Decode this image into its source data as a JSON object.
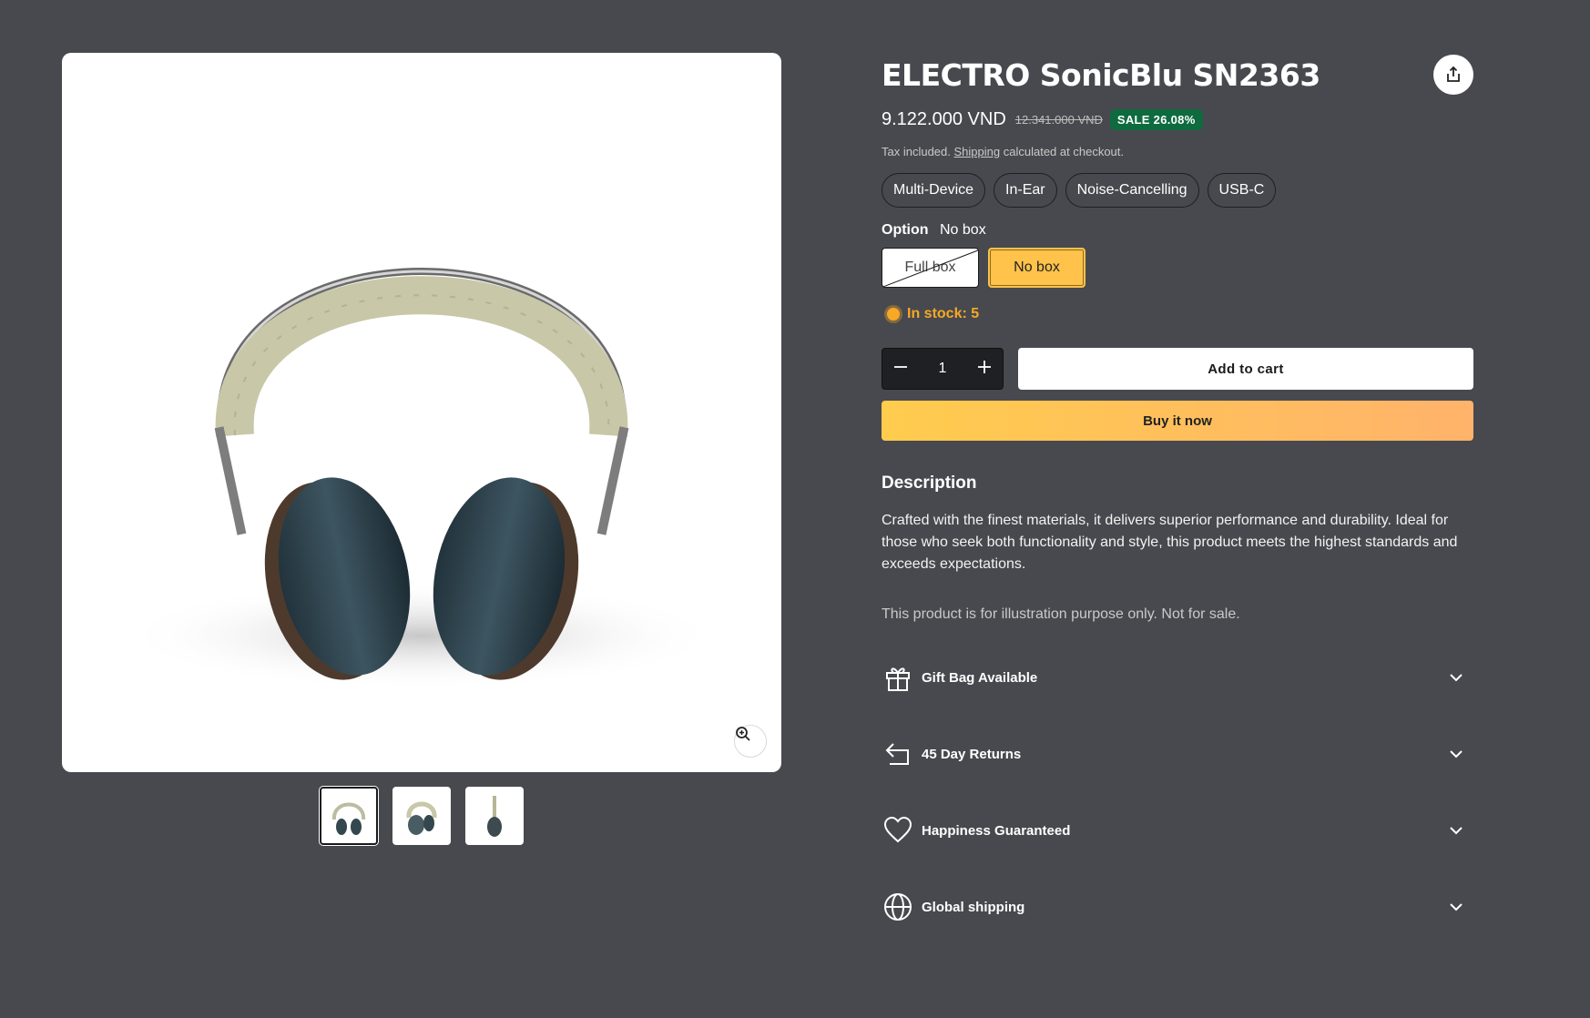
{
  "product": {
    "title": "ELECTRO SonicBlu SN2363",
    "price": "9.122.000 VND",
    "compare_price": "12.341.000 VND",
    "sale_badge": "SALE 26.08%",
    "tax_prefix": "Tax included.",
    "tax_link": "Shipping",
    "tax_suffix": "calculated at checkout.",
    "tags": [
      "Multi-Device",
      "In-Ear",
      "Noise-Cancelling",
      "USB-C"
    ]
  },
  "option": {
    "label": "Option",
    "selected_value": "No box",
    "choices": [
      {
        "label": "Full box",
        "state": "disabled"
      },
      {
        "label": "No box",
        "state": "selected"
      }
    ]
  },
  "stock": {
    "text": "In stock: 5"
  },
  "cart": {
    "quantity": "1",
    "add_to_cart": "Add to cart",
    "buy_now": "Buy it now"
  },
  "description": {
    "heading": "Description",
    "body": "Crafted with the finest materials, it delivers superior performance and durability. Ideal for those who seek both functionality and style, this product meets the highest standards and exceeds expectations.",
    "note": "This product is for illustration purpose only. Not for sale."
  },
  "accordions": [
    {
      "label": "Gift Bag Available",
      "icon": "gift-icon"
    },
    {
      "label": "45 Day Returns",
      "icon": "return-arrow-icon"
    },
    {
      "label": "Happiness Guaranteed",
      "icon": "heart-icon"
    },
    {
      "label": "Global shipping",
      "icon": "globe-icon"
    }
  ],
  "gallery": {
    "thumbnails": [
      "headphones-front",
      "headphones-angle",
      "headphones-side"
    ],
    "active_index": 0
  },
  "colors": {
    "page_bg": "#47494e",
    "sale_green": "#0e6b3f",
    "stock_orange": "#f7a825",
    "selected_option": "#ffc24a",
    "buy_gradient_start": "#ffcc4d",
    "buy_gradient_end": "#ffb36b"
  }
}
